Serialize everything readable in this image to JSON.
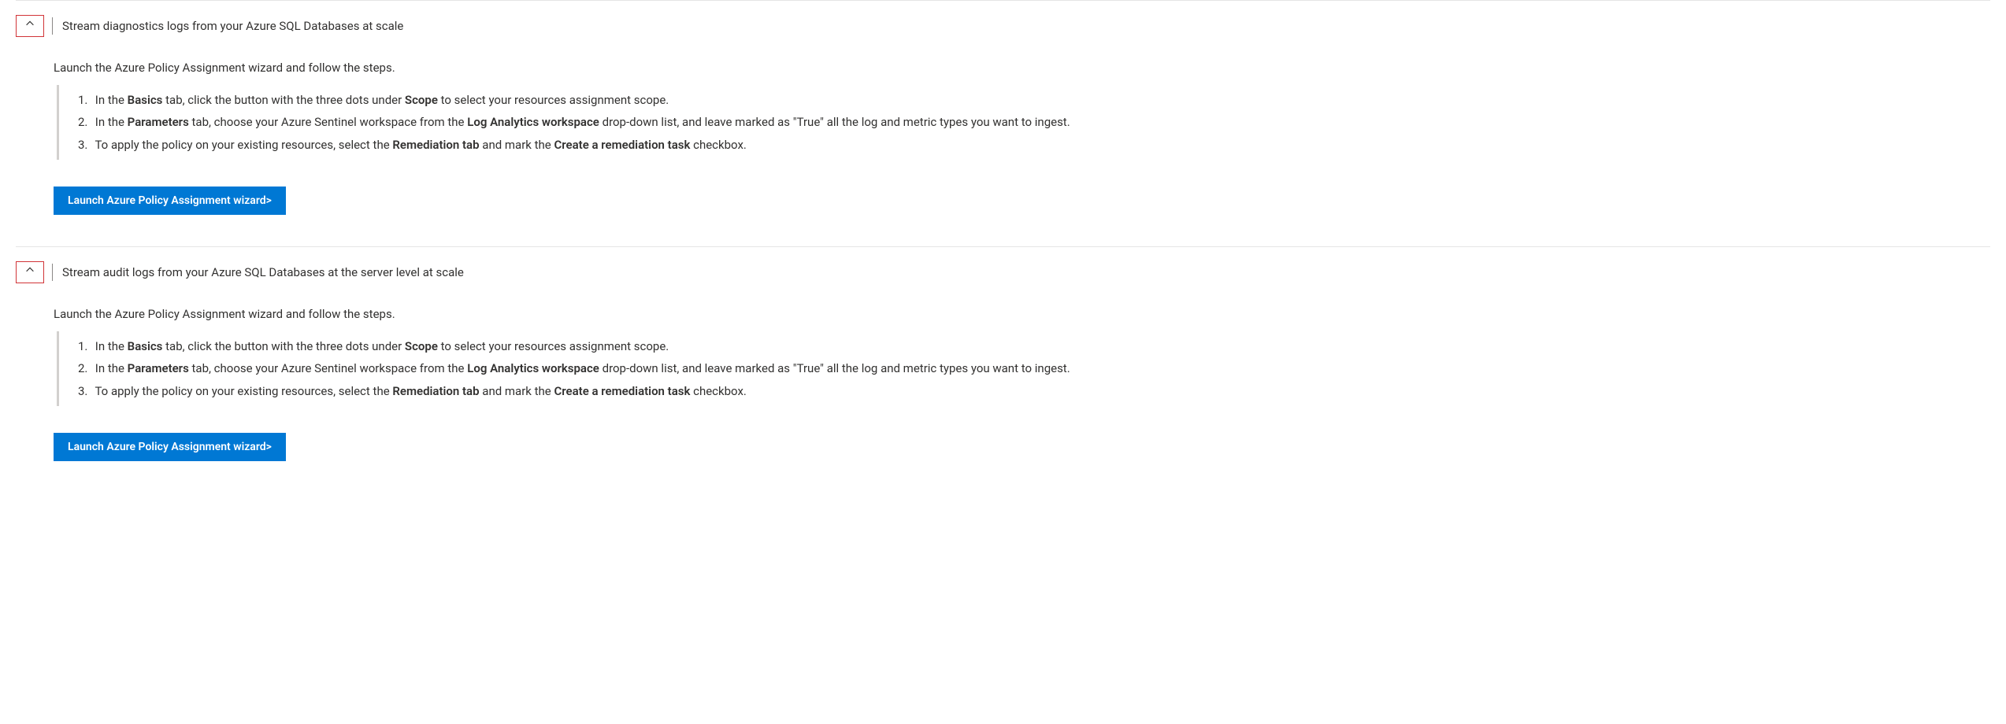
{
  "sections": [
    {
      "title": "Stream diagnostics logs from your Azure SQL Databases at scale",
      "intro": "Launch the Azure Policy Assignment wizard and follow the steps.",
      "steps": [
        {
          "num": "1.",
          "pre": "In the ",
          "bold1": "Basics",
          "mid1": " tab, click the button with the three dots under ",
          "bold2": "Scope",
          "post": " to select your resources assignment scope."
        },
        {
          "num": "2.",
          "pre": "In the ",
          "bold1": "Parameters",
          "mid1": " tab, choose your Azure Sentinel workspace from the ",
          "bold2": "Log Analytics workspace",
          "post": " drop-down list, and leave marked as \"True\" all the log and metric types you want to ingest."
        },
        {
          "num": "3.",
          "pre": "To apply the policy on your existing resources, select the ",
          "bold1": "Remediation tab",
          "mid1": " and mark the ",
          "bold2": "Create a remediation task",
          "post": " checkbox."
        }
      ],
      "button_label": "Launch Azure Policy Assignment wizard>"
    },
    {
      "title": "Stream audit logs from your Azure SQL Databases at the server level at scale",
      "intro": "Launch the Azure Policy Assignment wizard and follow the steps.",
      "steps": [
        {
          "num": "1.",
          "pre": "In the ",
          "bold1": "Basics",
          "mid1": " tab, click the button with the three dots under ",
          "bold2": "Scope",
          "post": " to select your resources assignment scope."
        },
        {
          "num": "2.",
          "pre": "In the ",
          "bold1": "Parameters",
          "mid1": " tab, choose your Azure Sentinel workspace from the ",
          "bold2": "Log Analytics workspace",
          "post": " drop-down list, and leave marked as \"True\" all the log and metric types you want to ingest."
        },
        {
          "num": "3.",
          "pre": "To apply the policy on your existing resources, select the ",
          "bold1": "Remediation tab",
          "mid1": " and mark the ",
          "bold2": "Create a remediation task",
          "post": " checkbox."
        }
      ],
      "button_label": "Launch Azure Policy Assignment wizard>"
    }
  ]
}
